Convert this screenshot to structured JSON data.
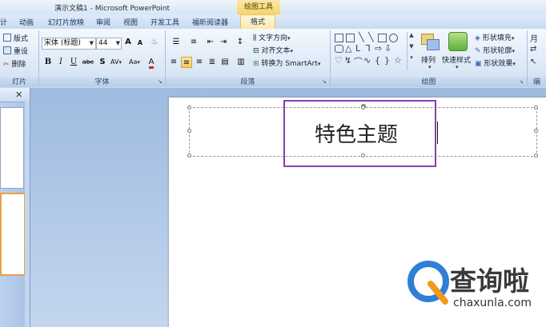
{
  "window": {
    "title": "演示文稿1 - Microsoft PowerPoint",
    "context_group": "绘图工具"
  },
  "tabs": [
    "计",
    "动画",
    "幻灯片放映",
    "审阅",
    "视图",
    "开发工具",
    "福昕阅读器",
    "格式"
  ],
  "ribbon": {
    "slides": {
      "layout": "版式",
      "reset": "重设",
      "delete": "删除",
      "label": "灯片"
    },
    "font": {
      "family": "宋体 (标题)",
      "size": "44",
      "label": "字体",
      "bold": "B",
      "italic": "I",
      "underline": "U",
      "strike": "abc",
      "shadow": "S",
      "spacing": "AV",
      "case": "Aa",
      "color": "A",
      "grow": "A",
      "shrink": "A"
    },
    "paragraph": {
      "text_direction": "文字方向",
      "align_text": "对齐文本",
      "smartart": "转换为 SmartArt",
      "label": "段落"
    },
    "drawing": {
      "arrange": "排列",
      "quick_styles": "快速样式",
      "fill": "形状填充",
      "outline": "形状轮廓",
      "effects": "形状效果",
      "label": "绘图"
    },
    "edit": {
      "label": "编"
    }
  },
  "slide": {
    "title": "特色主题"
  },
  "watermark": {
    "brand_cn": "查询啦",
    "brand_en": "chaxunla.com"
  },
  "colors": {
    "accent_highlight": "#8a3fb0",
    "active_button": "#f7c95f",
    "font_color_bar": "#d9261c"
  }
}
